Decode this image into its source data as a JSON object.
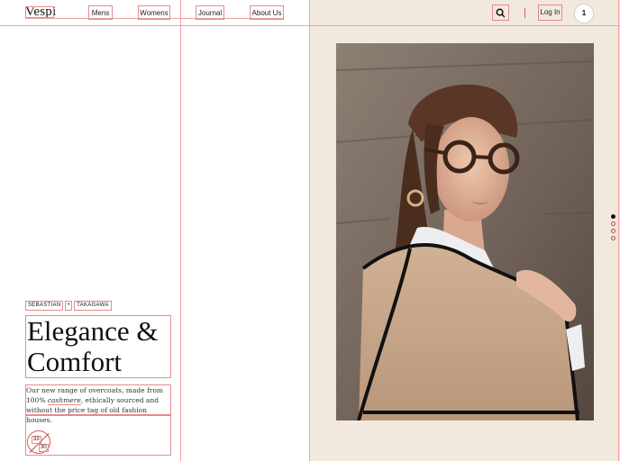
{
  "brand": {
    "logo": "Vespi"
  },
  "nav": {
    "items": [
      {
        "label": "Mens"
      },
      {
        "label": "Womens"
      },
      {
        "label": "Journal"
      },
      {
        "label": "About Us"
      }
    ]
  },
  "header": {
    "search_icon": "search-icon",
    "login_label": "Log In",
    "cart_count": "1"
  },
  "hero": {
    "designer_1": "SEBASTIAN",
    "designer_sep": "+",
    "designer_2": "TAKAGAWA",
    "headline_line1": "Elegance &",
    "headline_line2": "Comfort",
    "description_pre": "Our new range of overcoats, made from 100%",
    "description_em": "cashmere",
    "description_post": ", ethically sourced and without the price tag of old fashion houses.",
    "page_current": "33",
    "page_total": "30"
  },
  "colors": {
    "panel_bg": "#f1e8de",
    "guide": "#f2a0a0"
  },
  "carousel": {
    "active_index": 0,
    "dot_count": 4
  }
}
